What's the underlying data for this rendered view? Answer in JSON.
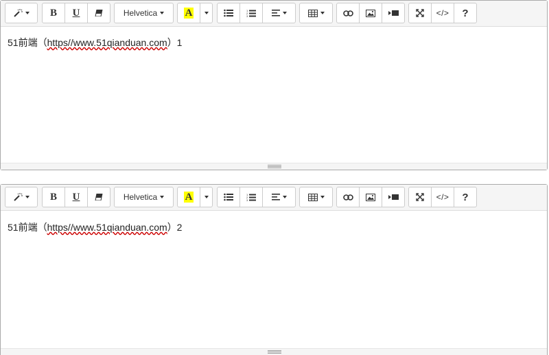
{
  "toolbar": {
    "font_name": "Helvetica",
    "bold_label": "B",
    "underline_label": "U",
    "highlight_label": "A",
    "code_label": "</>",
    "help_label": "?",
    "highlight_color": "#ffff00",
    "icons": [
      "magic-icon",
      "bold-icon",
      "underline-icon",
      "eraser-icon",
      "font-caret-icon",
      "highlight-icon",
      "color-dropdown-icon",
      "unordered-list-icon",
      "ordered-list-icon",
      "align-icon",
      "table-icon",
      "link-icon",
      "picture-icon",
      "video-icon",
      "fullscreen-icon",
      "codeview-icon",
      "help-icon"
    ]
  },
  "editors": [
    {
      "text_prefix": "51前端（",
      "link_text": "https//www.51qianduan.com",
      "text_suffix": "）1"
    },
    {
      "text_prefix": "51前端（",
      "link_text": "https//www.51qianduan.com",
      "text_suffix": "）2"
    }
  ]
}
